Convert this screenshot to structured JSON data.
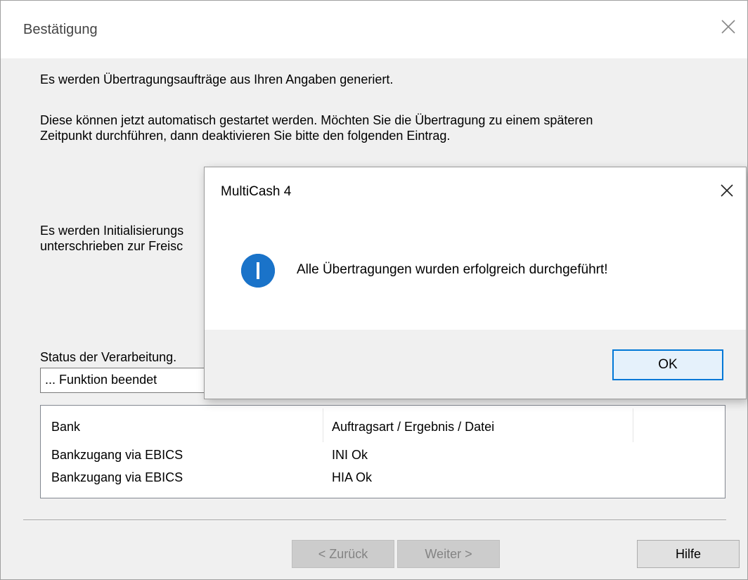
{
  "main_dialog": {
    "title": "Bestätigung",
    "line1": "Es werden Übertragungsaufträge aus Ihren Angaben generiert.",
    "line2": "Diese können jetzt automatisch gestartet werden. Möchten Sie die Übertragung zu einem späteren",
    "line3": "Zeitpunkt durchführen, dann deaktivieren Sie bitte den folgenden Eintrag.",
    "line4": "Es werden Initialisierungs",
    "line5": "unterschrieben zur Freisc",
    "status_label": "Status der Verarbeitung.",
    "status_value": "... Funktion beendet",
    "table": {
      "columns": [
        "Bank",
        "Auftragsart / Ergebnis / Datei"
      ],
      "rows": [
        [
          "Bankzugang via EBICS",
          "INI Ok"
        ],
        [
          "Bankzugang via EBICS",
          "HIA Ok"
        ]
      ]
    },
    "buttons": {
      "back": "< Zurück",
      "next": "Weiter >",
      "help": "Hilfe"
    }
  },
  "message_box": {
    "title": "MultiCash 4",
    "message": "Alle Übertragungen wurden erfolgreich durchgeführt!",
    "icon": "info-icon",
    "ok_label": "OK"
  },
  "colors": {
    "accent": "#0078d7",
    "info_icon": "#1a73c9"
  }
}
